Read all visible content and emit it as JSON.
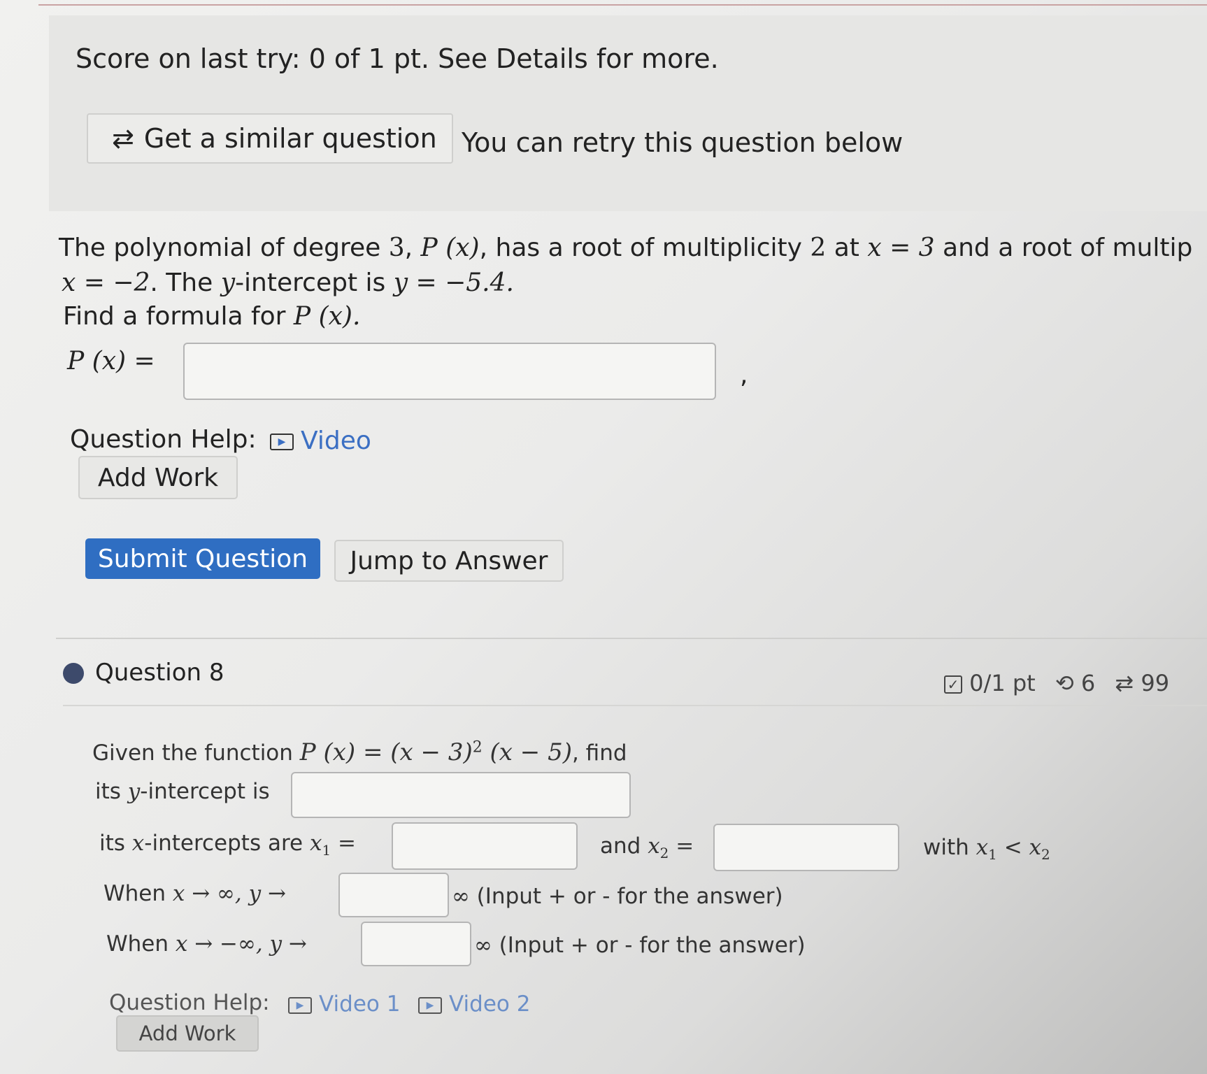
{
  "score": {
    "text": "Score on last try: 0 of 1 pt. See Details for more.",
    "similar_button": "Get a similar question",
    "retry_text": "You can retry this question below"
  },
  "question7": {
    "line1_a": "The polynomial of degree ",
    "degree": "3",
    "line1_b": ", ",
    "px": "P (x)",
    "line1_c": ", has a root of multiplicity ",
    "mult": "2",
    "line1_d": " at ",
    "root1": "x = 3",
    "line1_e": " and a root of multip",
    "root2": "x = −2",
    "line2_a": ". The ",
    "y_var": "y",
    "line2_b": "-intercept is ",
    "yint": "y = −5.4.",
    "line3_a": "Find a formula for ",
    "line3_px": "P (x).",
    "answer_label": "P (x) =",
    "answer_value": "",
    "trailing_comma": ",",
    "help_label": "Question Help:",
    "video_label": "Video",
    "add_work": "Add Work",
    "submit": "Submit Question",
    "jump": "Jump to Answer"
  },
  "question8": {
    "title": "Question 8",
    "points": "0/1 pt",
    "retries": "6",
    "attempts": "99",
    "given_a": "Given the function ",
    "given_func": "P (x) = (x − 3)",
    "given_exp": "2",
    "given_func2": " (x − 5)",
    "given_b": ", find",
    "yint_a": "its ",
    "yint_var": "y",
    "yint_b": "-intercept is",
    "xint_a": "its ",
    "xint_var": "x",
    "xint_b": "-intercepts are ",
    "x1": "x",
    "x1_sub": "1",
    "eq": " =",
    "and": "and ",
    "x2": "x",
    "x2_sub": "2",
    "with": "with ",
    "cmp_a": "x",
    "cmp_a_sub": "1",
    "cmp_lt": " < ",
    "cmp_b": "x",
    "cmp_b_sub": "2",
    "when1_a": "When ",
    "when1_math": "x → ∞, y →",
    "when2_math": "x → −∞, y →",
    "inf": "∞",
    "input_hint": " (Input + or - for the answer)",
    "help_label": "Question Help:",
    "video1": "Video 1",
    "video2": "Video 2",
    "add_work": "Add Work"
  }
}
